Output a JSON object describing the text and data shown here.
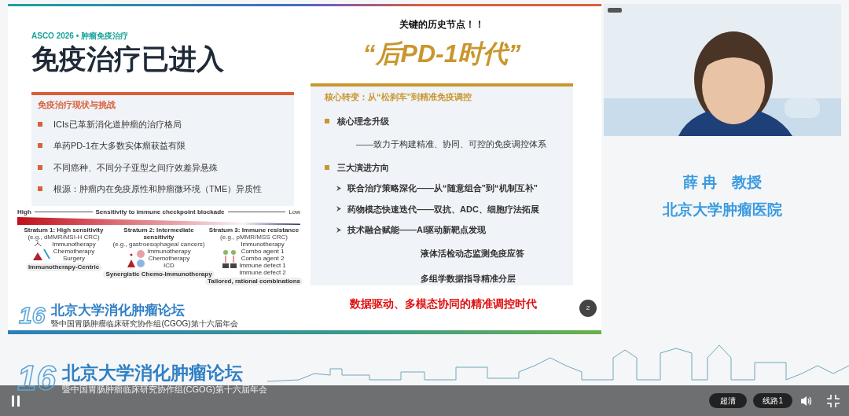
{
  "slide": {
    "tag": "ASCO 2026 • 肿瘤免疫治疗",
    "title": "免疫治疗已进入",
    "subtitle": "关键的历史节点！！",
    "highlight": "“后PD-1时代”",
    "left_card": {
      "heading": "免疫治疗现状与挑战",
      "items": [
        "ICIs已革新消化道肿瘤的治疗格局",
        "单药PD-1在大多数实体瘤获益有限",
        "不同癌种、不同分子亚型之间疗效差异悬殊",
        "根源：肿瘤内在免疫原性和肿瘤微环境（TME）异质性"
      ]
    },
    "figure": {
      "axis_high": "High",
      "axis_label": "Sensitivity to immune checkpoint blockade",
      "axis_low": "Low",
      "strata": [
        {
          "title": "Stratum 1: High sensitivity",
          "example": "(e.g., dMMR/MSI-H CRC)",
          "labels": [
            "Immunotherapy",
            "Chemotherapy",
            "Surgery"
          ],
          "approach": "Immunotherapy-Centric"
        },
        {
          "title": "Stratum 2: Intermediate sensitivity",
          "example": "(e.g., gastroesophageal cancers)",
          "labels": [
            "Immunotherapy",
            "Chemotherapy",
            "ICD"
          ],
          "approach": "Synergistic Chemo-Immunotherapy"
        },
        {
          "title": "Stratum 3: Immune resistance",
          "example": "(e.g., pMMR/MSS CRC)",
          "labels": [
            "Immunotherapy",
            "Combo agent 1",
            "Combo agent 2",
            "Immune defect 1",
            "Immune defect 2"
          ],
          "approach": "Tailored, rational combinations"
        }
      ]
    },
    "right_card": {
      "heading": "核心转变：从“松刹车”到精准免疫调控",
      "items": [
        {
          "kind": "bullet",
          "text": "核心理念升级"
        },
        {
          "kind": "note",
          "text": "——致力于构建精准、协同、可控的免疫调控体系"
        },
        {
          "kind": "bullet",
          "text": "三大演进方向"
        },
        {
          "kind": "arrow",
          "text": "联合治疗策略深化——从“随意组合”到“机制互补”"
        },
        {
          "kind": "arrow",
          "text": "药物模态快速迭代——双抗、ADC、细胞疗法拓展"
        },
        {
          "kind": "arrow",
          "text": "技术融合赋能——AI驱动新靶点发现"
        },
        {
          "kind": "sub",
          "text": "液体活检动态监测免疫应答"
        },
        {
          "kind": "sub",
          "text": "多组学数据指导精准分层"
        }
      ]
    },
    "conclusion": "数据驱动、多模态协同的精准调控时代",
    "page_number": "2",
    "footer_logo": {
      "number": "16",
      "name": "北京大学消化肿瘤论坛",
      "subtitle": "暨中国胃肠肿瘤临床研究协作组(CGOG)第十六届年会"
    }
  },
  "speaker": {
    "name": "薛 冉　教授",
    "affiliation": "北京大学肿瘤医院"
  },
  "banner": {
    "number": "16",
    "name": "北京大学消化肿瘤论坛",
    "subtitle": "暨中国胃肠肿瘤临床研究协作组(CGOG)第十六届年会"
  },
  "player": {
    "playing": true,
    "quality": "超清",
    "line": "线路1"
  }
}
